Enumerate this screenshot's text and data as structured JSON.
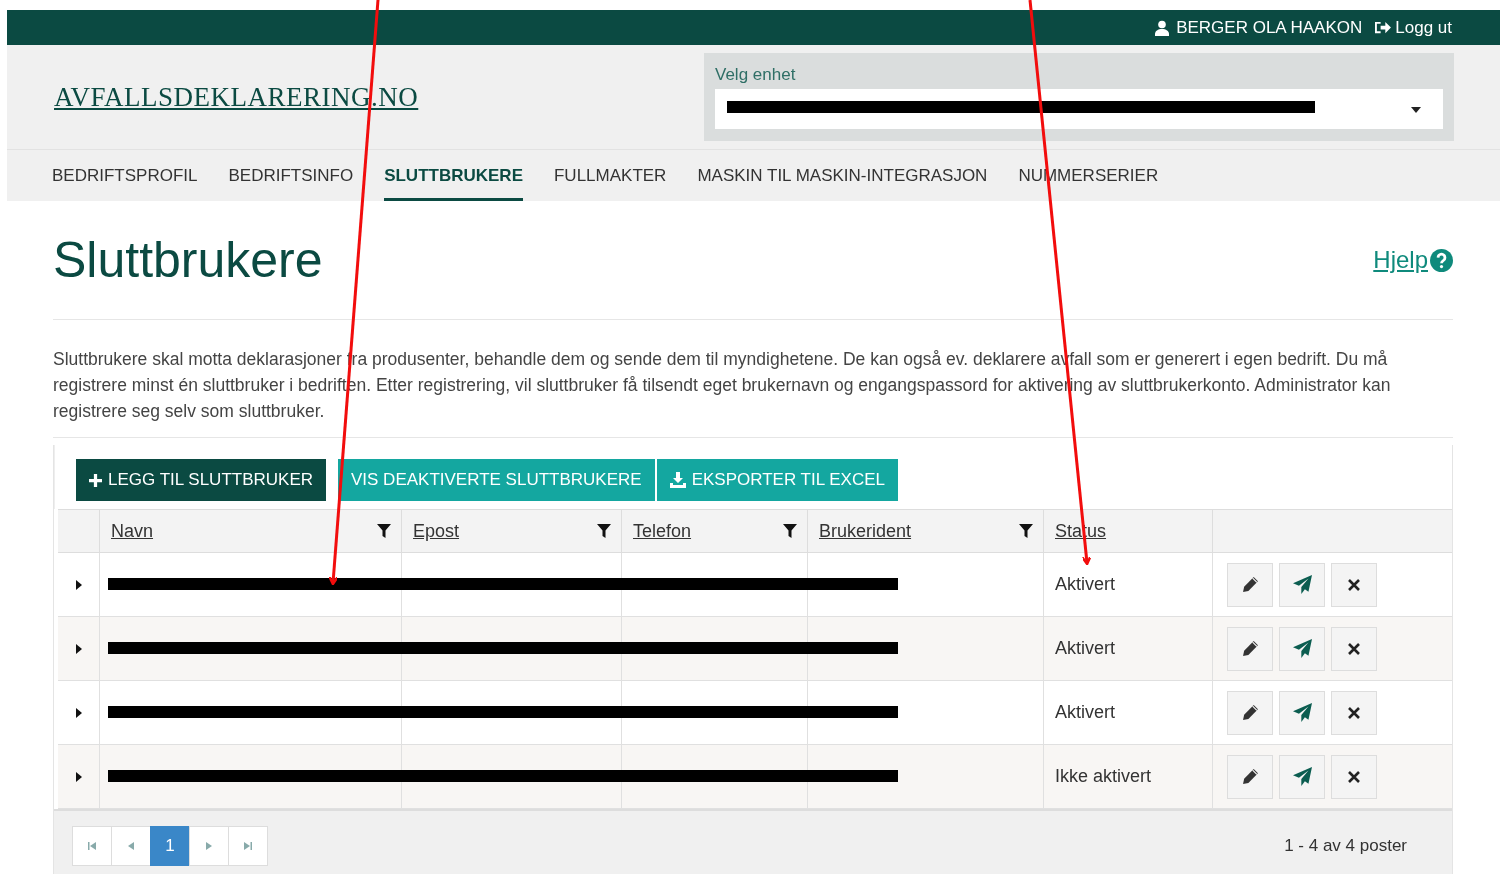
{
  "user": {
    "name": "BERGER OLA HAAKON",
    "logout": "Logg ut"
  },
  "logo": "AVFALLSDEKLARERING.NO",
  "unit_select": {
    "label": "Velg enhet",
    "redacted": true
  },
  "nav": [
    {
      "label": "BEDRIFTSPROFIL",
      "selected": false
    },
    {
      "label": "BEDRIFTSINFO",
      "selected": false
    },
    {
      "label": "SLUTTBRUKERE",
      "selected": true
    },
    {
      "label": "FULLMAKTER",
      "selected": false
    },
    {
      "label": "MASKIN TIL MASKIN-INTEGRASJON",
      "selected": false
    },
    {
      "label": "NUMMERSERIER",
      "selected": false
    }
  ],
  "title": "Sluttbrukere",
  "help": "Hjelp",
  "description": "Sluttbrukere skal motta deklarasjoner fra produsenter, behandle dem og sende dem til myndighetene. De kan også ev. deklarere avfall som er generert i egen bedrift. Du må registrere minst én sluttbruker i bedriften. Etter registrering, vil sluttbruker få tilsendt eget brukernavn og engangspassord for aktivering av sluttbrukerkonto. Administrator kan registrere seg selv som sluttbruker.",
  "actions": [
    {
      "label": "LEGG TIL SLUTTBRUKER",
      "kind": "add"
    },
    {
      "label": "VIS DEAKTIVERTE SLUTTBRUKERE",
      "kind": "plain"
    },
    {
      "label": "EKSPORTER TIL EXCEL",
      "kind": "export"
    }
  ],
  "table": {
    "columns": [
      {
        "label": "Navn",
        "filter": true
      },
      {
        "label": "Epost",
        "filter": true
      },
      {
        "label": "Telefon",
        "filter": true
      },
      {
        "label": "Brukerident",
        "filter": true
      },
      {
        "label": "Status",
        "filter": false
      }
    ],
    "rows": [
      {
        "status": "Aktivert",
        "redacted": true
      },
      {
        "status": "Aktivert",
        "redacted": true
      },
      {
        "status": "Aktivert",
        "redacted": true
      },
      {
        "status": "Ikke aktivert",
        "redacted": true
      }
    ]
  },
  "pagination": {
    "pages": [
      {
        "label": "1",
        "selected": true
      }
    ],
    "summary": "1 - 4 av 4 poster"
  }
}
